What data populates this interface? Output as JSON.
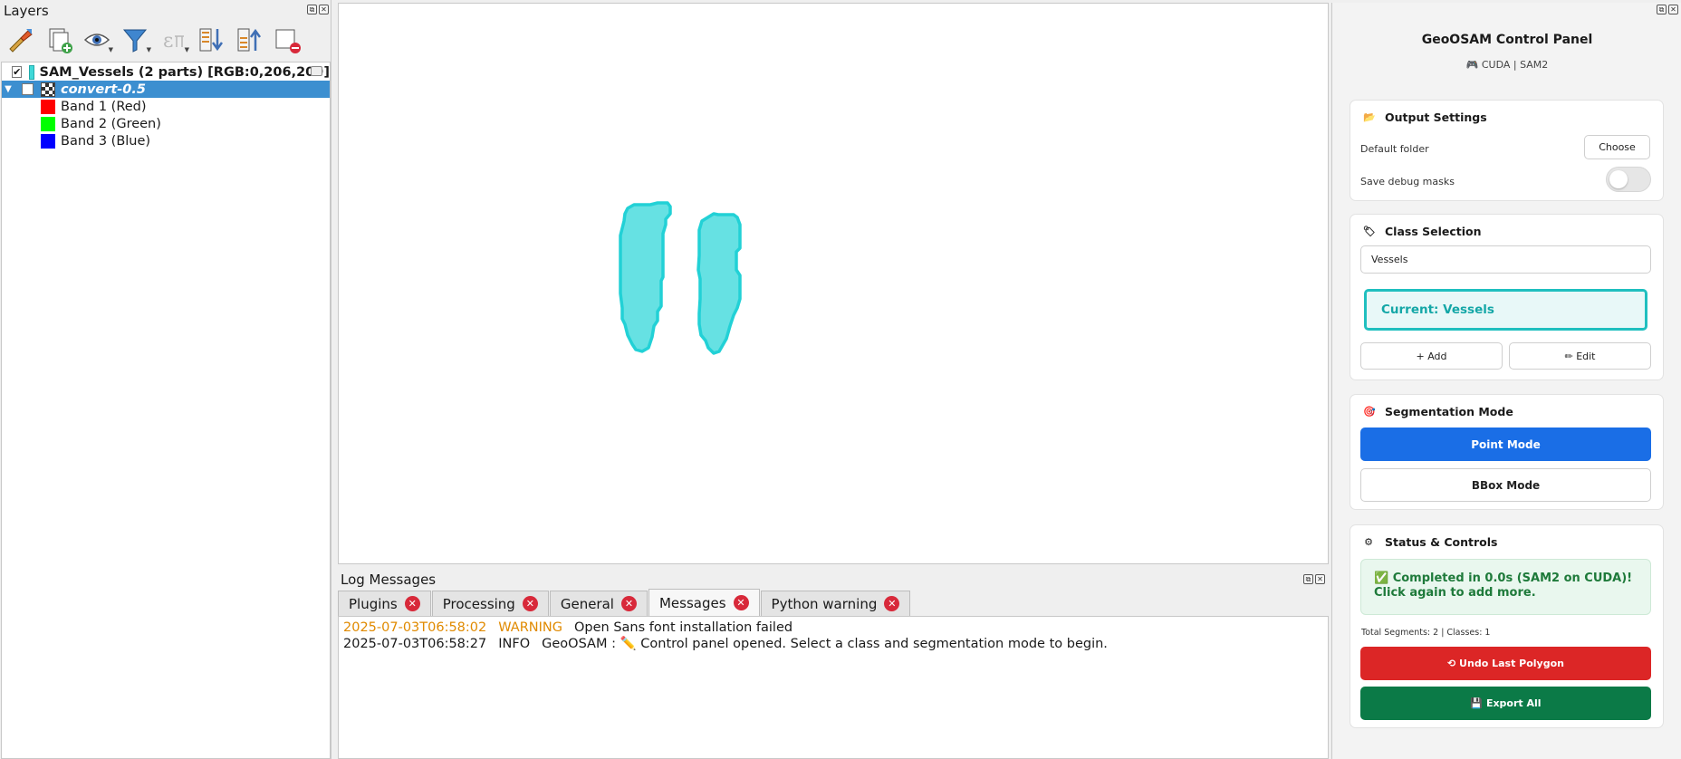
{
  "layers_panel": {
    "title": "Layers",
    "toolbar": [
      {
        "name": "style-manager-icon"
      },
      {
        "name": "add-group-icon"
      },
      {
        "name": "visibility-eye-icon"
      },
      {
        "name": "filter-legend-icon"
      },
      {
        "name": "filter-expression-icon"
      },
      {
        "name": "expand-all-icon"
      },
      {
        "name": "collapse-all-icon"
      },
      {
        "name": "remove-layer-icon"
      }
    ],
    "layers": [
      {
        "label": "SAM_Vessels (2 parts) [RGB:0,206,209]",
        "checked": true,
        "swatch": "#40d8d8"
      },
      {
        "label": "convert-0.5",
        "checked": false,
        "selected": true
      }
    ],
    "bands": [
      {
        "label": "Band 1 (Red)",
        "color": "#ff0000"
      },
      {
        "label": "Band 2 (Green)",
        "color": "#00ff00"
      },
      {
        "label": "Band 3 (Blue)",
        "color": "#0000ff"
      }
    ]
  },
  "map": {
    "fill_color": "#66e1e3",
    "stroke_color": "#22d1d6"
  },
  "log": {
    "title": "Log Messages",
    "tabs": [
      "Plugins",
      "Processing",
      "General",
      "Messages",
      "Python warning"
    ],
    "active_tab": "Messages",
    "lines": [
      {
        "time": "2025-07-03T06:58:02",
        "level": "WARNING",
        "message": "Open Sans font installation failed"
      },
      {
        "time": "2025-07-03T06:58:27",
        "level": "INFO",
        "message": "GeoOSAM : ✏️ Control panel opened. Select a class and segmentation mode to begin."
      }
    ]
  },
  "geo": {
    "title": "GeoOSAM Control Panel",
    "subtitle": "🎮 CUDA | SAM2",
    "output": {
      "header": "Output Settings",
      "default_folder_label": "Default folder",
      "choose_label": "Choose",
      "debug_label": "Save debug masks",
      "debug_enabled": false
    },
    "class_selection": {
      "header": "Class Selection",
      "selected_class": "Vessels",
      "current_label": "Current: Vessels",
      "add_label": "+ Add",
      "edit_label": "✏ Edit"
    },
    "segmentation": {
      "header": "Segmentation Mode",
      "point_mode": "Point Mode",
      "bbox_mode": "BBox Mode"
    },
    "status": {
      "header": "Status & Controls",
      "message": "✅ Completed in 0.0s (SAM2 on CUDA)! Click again to add more.",
      "totals": "Total Segments: 2 | Classes: 1",
      "undo_label": "⟲ Undo Last Polygon",
      "export_label": "💾 Export All"
    },
    "colors": {
      "primary": "#1a6ee6",
      "danger": "#dc2626",
      "success": "#0b7a47",
      "accent": "#1fbfbf"
    }
  }
}
